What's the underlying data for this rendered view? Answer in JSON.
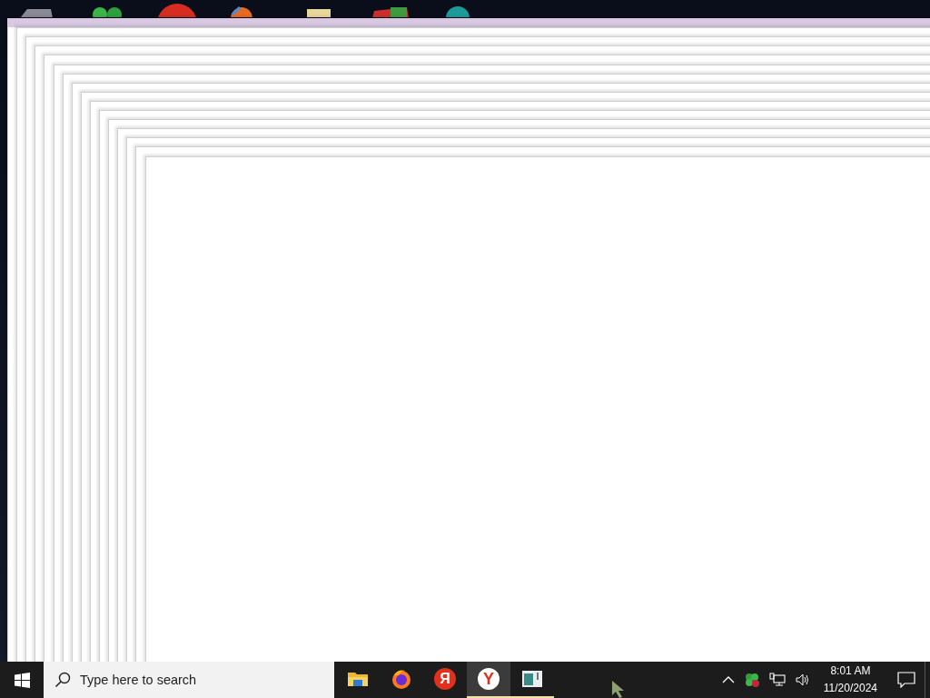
{
  "taskbar": {
    "search": {
      "placeholder": "Type here to search"
    },
    "apps": [
      {
        "kind": "folder",
        "selected": false,
        "running": false
      },
      {
        "kind": "firefox",
        "selected": false,
        "running": false
      },
      {
        "kind": "yandex",
        "glyph": "Я",
        "selected": false,
        "running": false
      },
      {
        "kind": "ybrowser",
        "glyph": "Y",
        "selected": true,
        "running": true
      },
      {
        "kind": "appwindow",
        "selected": false,
        "running": true
      }
    ],
    "clock": {
      "time": "8:01 AM",
      "date": "11/20/2024"
    }
  }
}
